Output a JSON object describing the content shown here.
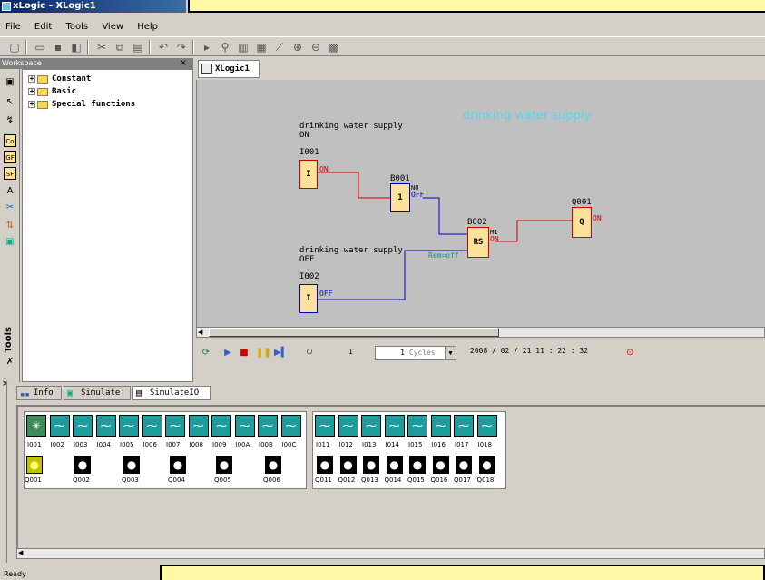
{
  "app": {
    "title": "xLogic - XLogic1",
    "status": "Ready"
  },
  "menu": [
    "File",
    "Edit",
    "Tools",
    "View",
    "Help"
  ],
  "toolbar_icons": [
    "new-icon",
    "open-icon",
    "save-icon",
    "save-all-icon",
    "cut-icon",
    "copy-icon",
    "paste-icon",
    "undo-icon",
    "redo-icon",
    "simulate-icon",
    "probe-icon",
    "print-icon",
    "print-preview-icon",
    "connect-icon",
    "zoom-in-icon",
    "zoom-out-icon",
    "grid-icon"
  ],
  "workspace": {
    "title": "Workspace",
    "close": "×",
    "tree": [
      {
        "label": "Constant"
      },
      {
        "label": "Basic"
      },
      {
        "label": "Special functions"
      }
    ],
    "tools_label": "Tools",
    "tool_labels": [
      "Co",
      "GF",
      "SF"
    ]
  },
  "document_tab": "XLogic1",
  "canvas": {
    "title": "drinking water supply",
    "label_on_1": "drinking water supply",
    "label_on_2": "ON",
    "label_off_1": "drinking water supply",
    "label_off_2": "OFF",
    "blocks": {
      "i001": {
        "id": "I001",
        "symbol": "I",
        "state": "ON"
      },
      "b001": {
        "id": "B001",
        "symbol": "1",
        "pin": "NO",
        "state": "OFF"
      },
      "b002": {
        "id": "B002",
        "symbol": "RS",
        "pin": "M1",
        "state": "ON",
        "rem": "Rem=off"
      },
      "q001": {
        "id": "Q001",
        "symbol": "Q",
        "state": "ON"
      },
      "i002": {
        "id": "I002",
        "symbol": "I",
        "state": "OFF"
      }
    }
  },
  "simulation": {
    "step": "1",
    "cycles_value": "1",
    "cycles_label": "Cycles",
    "datetime": "2008 / 02 / 21 11 : 22 : 32"
  },
  "bottom_tabs": [
    "Info",
    "Simulate",
    "SimulateIO"
  ],
  "inputs_group1": [
    "I001",
    "I002",
    "I003",
    "I004",
    "I005",
    "I006",
    "I007",
    "I008",
    "I009",
    "I00A",
    "I00B",
    "I00C"
  ],
  "inputs_group2": [
    "I011",
    "I012",
    "I013",
    "I014",
    "I015",
    "I016",
    "I017",
    "I018"
  ],
  "outputs_group1": [
    "Q001",
    "Q002",
    "Q003",
    "Q004",
    "Q005",
    "Q006"
  ],
  "outputs_group2": [
    "Q011",
    "Q012",
    "Q013",
    "Q014",
    "Q015",
    "Q016",
    "Q017",
    "Q018"
  ],
  "output_states": {
    "Q001": "on"
  },
  "colors": {
    "accent_red": "#d00000",
    "accent_blue": "#0000c0",
    "title_cyan": "#5ad2ec",
    "note_yellow": "#fff9a6",
    "input_teal": "#1e9c9c",
    "lamp_on": "#c6c100"
  }
}
